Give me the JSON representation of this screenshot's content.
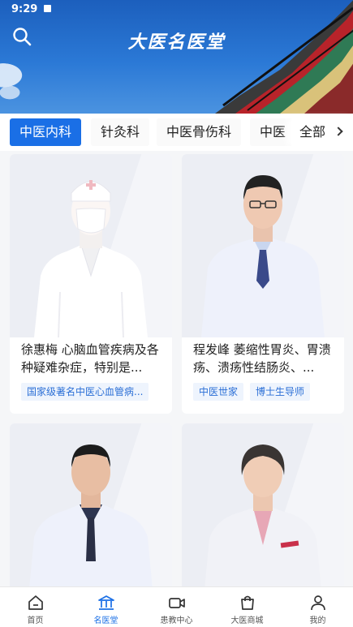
{
  "status": {
    "time": "9:29"
  },
  "header": {
    "title": "大医名医堂"
  },
  "tabs": {
    "items": [
      {
        "label": "中医内科"
      },
      {
        "label": "针灸科"
      },
      {
        "label": "中医骨伤科"
      },
      {
        "label": "中医"
      }
    ],
    "more_label": "全部"
  },
  "doctors": [
    {
      "text": "徐惠梅 心脑血管疾病及各种疑难杂症，特别是...",
      "tags": [
        "国家级著名中医心血管病..."
      ]
    },
    {
      "text": "程发峰 萎缩性胃炎、胃溃疡、溃疡性结肠炎、...",
      "tags": [
        "中医世家",
        "博士生导师"
      ]
    },
    {
      "text": "",
      "tags": []
    },
    {
      "text": "",
      "tags": []
    }
  ],
  "nav": [
    {
      "label": "首页"
    },
    {
      "label": "名医堂"
    },
    {
      "label": "患教中心"
    },
    {
      "label": "大医商城"
    },
    {
      "label": "我的"
    }
  ],
  "colors": {
    "accent": "#1a6fe6",
    "banner": "#2b79d6"
  }
}
